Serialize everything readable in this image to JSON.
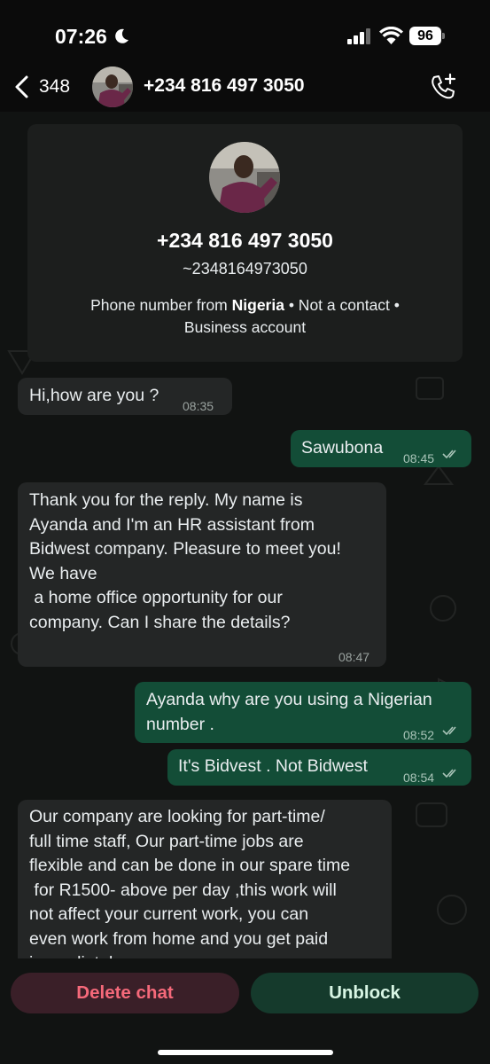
{
  "status_bar": {
    "time": "07:26",
    "battery": "96"
  },
  "header": {
    "back_count": "348",
    "title": "+234 816 497 3050"
  },
  "contact_card": {
    "phone": "+234 816 497 3050",
    "alias": "~2348164973050",
    "info_prefix": "Phone number from ",
    "country": "Nigeria",
    "info_suffix": " • Not a contact •",
    "info_line2": "Business account"
  },
  "messages": [
    {
      "direction": "in",
      "text": "Hi,how are you ?",
      "time": "08:35"
    },
    {
      "direction": "out",
      "text": "Sawubona",
      "time": "08:45"
    },
    {
      "direction": "in",
      "text": "Thank you for the reply. My name is\nAyanda and I'm an HR assistant from\nBidwest company. Pleasure to meet you!\nWe have\n a home office opportunity for our\ncompany. Can I share the details?",
      "time": "08:47"
    },
    {
      "direction": "out",
      "text": "Ayanda why are you using a Nigerian\nnumber .",
      "time": "08:52"
    },
    {
      "direction": "out",
      "text": "It's Bidvest . Not Bidwest",
      "time": "08:54"
    },
    {
      "direction": "in",
      "text": "Our company are looking for part-time/\nfull time staff, Our part-time jobs are\nflexible and can be done in our spare time\n for R1500- above per day ,this work will\nnot affect your current work, you can\neven work from home and you get paid\nimmediately",
      "time": ""
    }
  ],
  "actions": {
    "delete_label": "Delete chat",
    "unblock_label": "Unblock"
  },
  "colors": {
    "incoming_bubble": "#242626",
    "outgoing_bubble": "#134d37",
    "delete_text": "#f5697a",
    "unblock_bg": "#153a2c"
  },
  "icons": [
    "moon-icon",
    "signal-icon",
    "wifi-icon",
    "battery-icon",
    "back-chevron-icon",
    "add-call-icon",
    "double-check-icon"
  ]
}
